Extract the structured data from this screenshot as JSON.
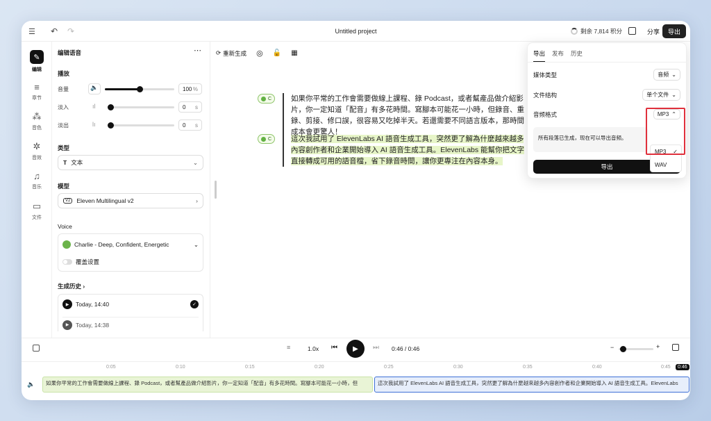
{
  "app": {
    "title": "Untitled project",
    "credits": "剩余 7,814 积分",
    "share": "分享",
    "export": "导出"
  },
  "rail": [
    {
      "icon": "wand-icon",
      "label": "编辑"
    },
    {
      "icon": "list-icon",
      "label": "章节"
    },
    {
      "icon": "voices-icon",
      "label": "音色"
    },
    {
      "icon": "effects-icon",
      "label": "音效"
    },
    {
      "icon": "music-icon",
      "label": "音乐"
    },
    {
      "icon": "folder-icon",
      "label": "文件"
    }
  ],
  "side": {
    "header": "编辑语音",
    "playback": "播放",
    "volume_label": "音量",
    "volume_value": "100",
    "volume_unit": "%",
    "volume_level": 100,
    "fadein_label": "淡入",
    "fadein_value": "0",
    "fadein_unit": "s",
    "fadeout_label": "淡出",
    "fadeout_value": "0",
    "fadeout_unit": "s",
    "type_label": "类型",
    "type_value": "文本",
    "model_label": "模型",
    "model_badge": "V2",
    "model_value": "Eleven Multilingual v2",
    "voice_label": "Voice",
    "voice_value": "Charlie - Deep, Confident, Energetic",
    "override_label": "覆盖设置",
    "history_label": "生成历史",
    "history": [
      {
        "time": "Today, 14:40"
      },
      {
        "time": "Today, 14:38"
      }
    ]
  },
  "toolbar": {
    "regenerate": "重新生成"
  },
  "paragraphs": [
    {
      "badge": "C",
      "text": "如果你平常的工作會需要做線上課程、錄 Podcast，或者幫產品做介紹影片，你一定知道「配音」有多花時間。寫腳本可能花一小時，但錄音、重錄、剪接、修口誤，很容易又吃掉半天。若還需要不同語言版本，那時間成本會更驚人！"
    },
    {
      "badge": "C",
      "text": "這次我試用了 ElevenLabs AI 語音生成工具，突然更了解為什麼越來越多內容創作者和企業開始導入 AI 語音生成工具。ElevenLabs 能幫你把文字直接轉成可用的語音檔，省下錄音時間，讓你更專注在內容本身。"
    }
  ],
  "export_panel": {
    "tabs": [
      "导出",
      "发布",
      "历史"
    ],
    "media_label": "媒体类型",
    "media_value": "音频",
    "structure_label": "文件结构",
    "structure_value": "单个文件",
    "format_label": "音频格式",
    "format_value": "MP3",
    "note": "所有段落已生成，现在可以导出音频。",
    "export_button": "导出",
    "options": [
      "MP3",
      "WAV"
    ]
  },
  "player": {
    "speed": "1.0x",
    "current": "0:46",
    "total": "0:46"
  },
  "timeline": {
    "ticks": [
      "0:05",
      "0:10",
      "0:15",
      "0:20",
      "0:25",
      "0:30",
      "0:35",
      "0:40",
      "0:45"
    ],
    "playhead": "0:46",
    "clips": [
      "如果你平常的工作會需要做線上課程、錄 Podcast，或者幫產品做介紹影片，你一定知道「配音」有多花時間。寫腳本可能花一小時，但",
      "這次我試用了 ElevenLabs AI 語音生成工具，突然更了解為什麼越來越多內容創作者和企業開始導入 AI 語音生成工具。ElevenLabs"
    ]
  },
  "colors": {
    "accent": "#111111",
    "highlight": "#e7f5c8",
    "alert": "#e0303c"
  }
}
